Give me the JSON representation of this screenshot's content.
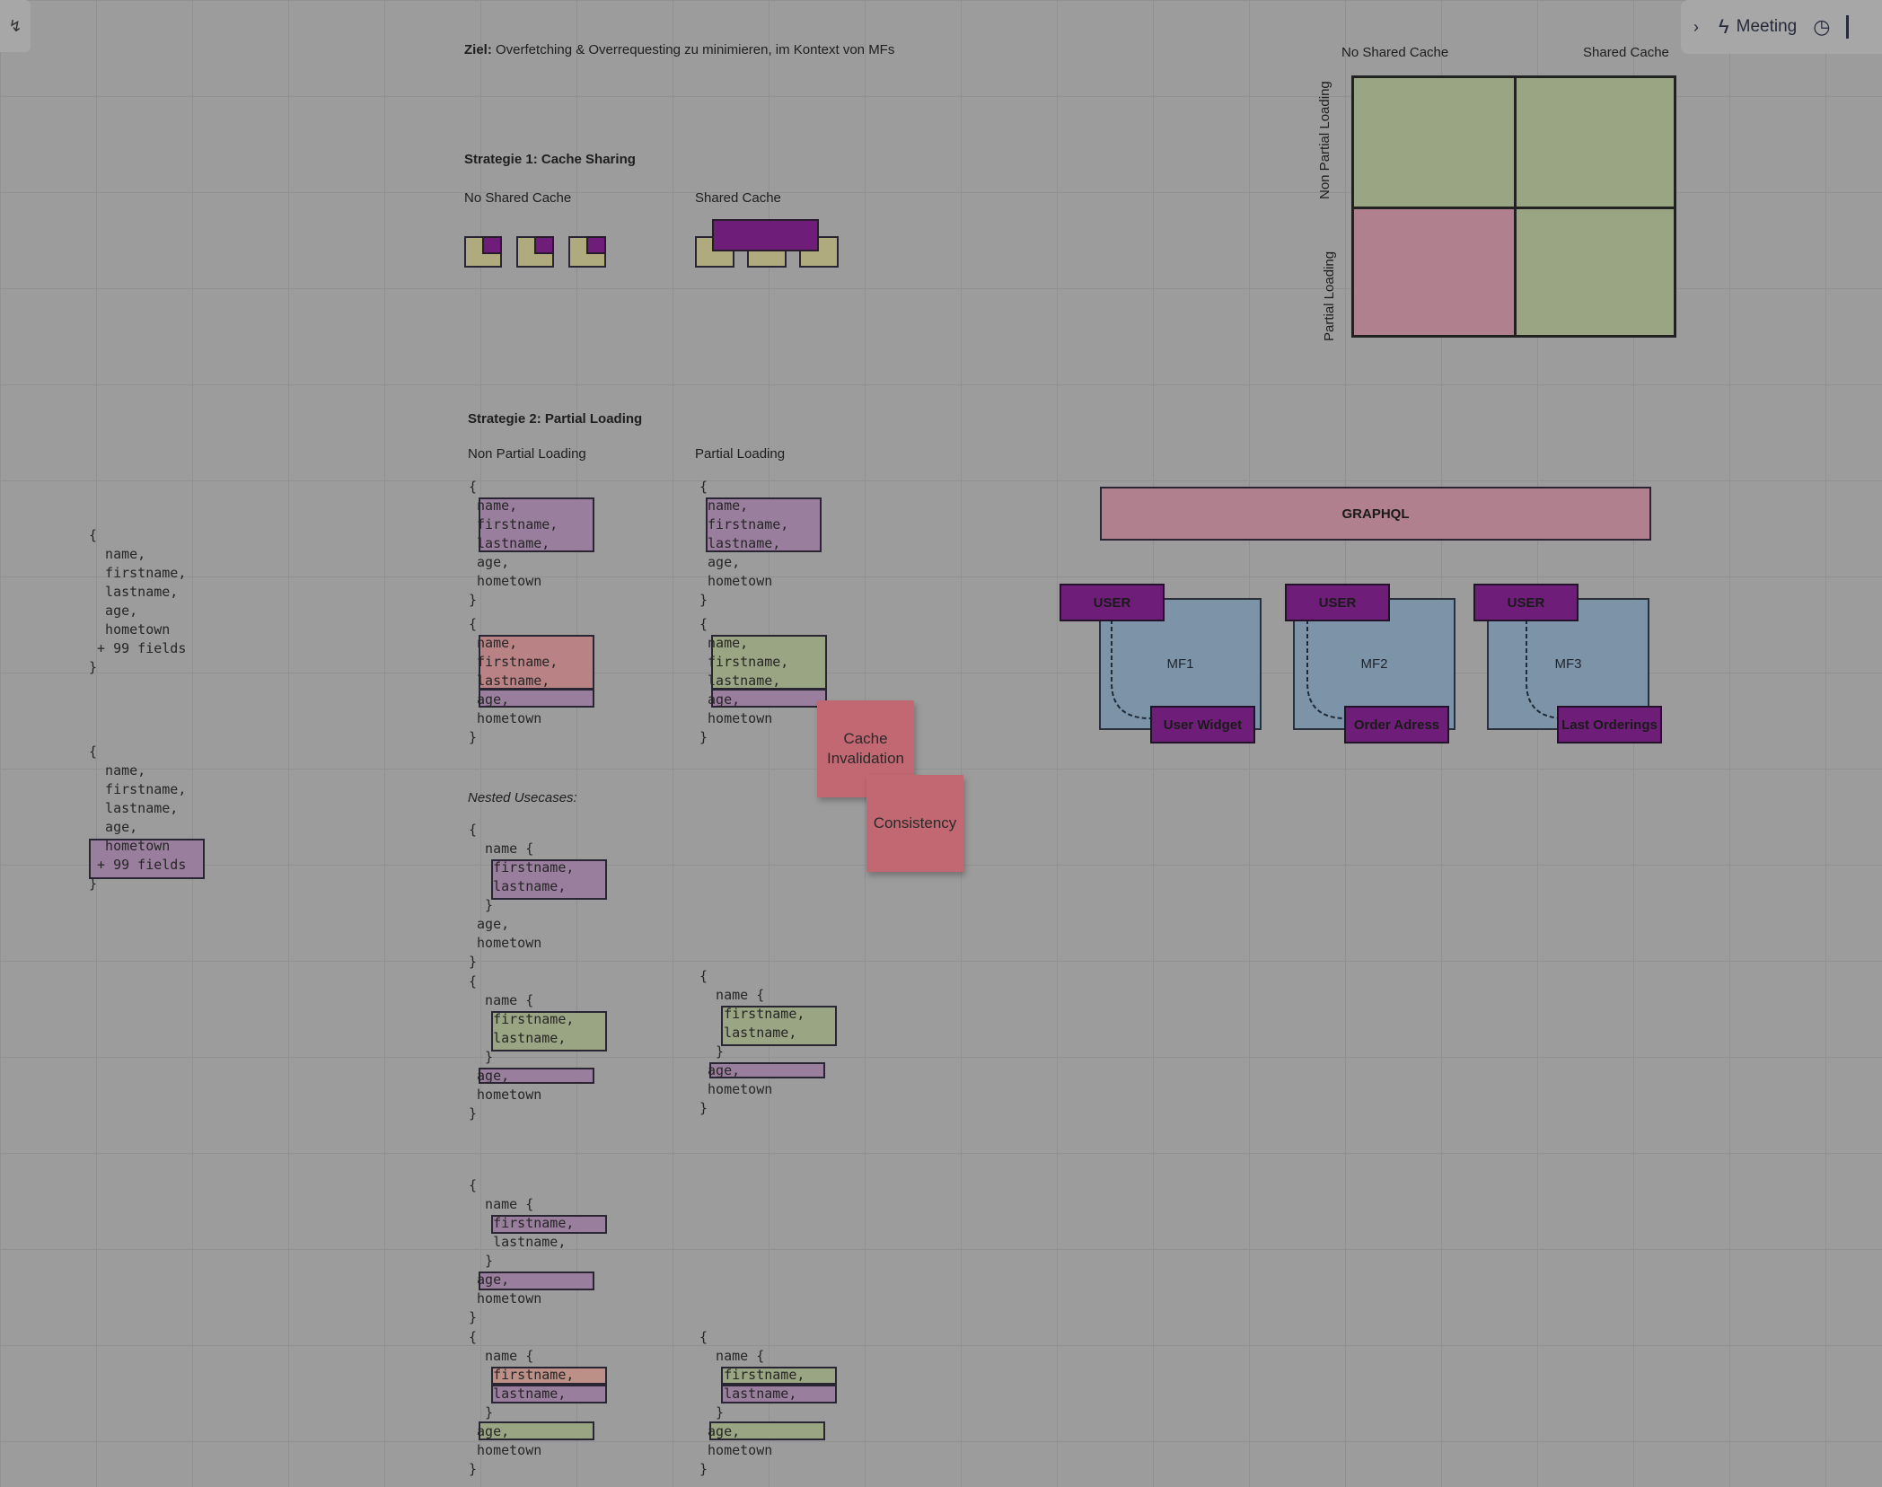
{
  "toolbar": {
    "meeting_label": "Meeting"
  },
  "goal": {
    "label": "Ziel:",
    "text": " Overfetching & Overrequesting zu minimieren, im Kontext von MFs"
  },
  "strategy1": {
    "title": "Strategie 1: Cache Sharing",
    "no_shared": "No Shared Cache",
    "shared": "Shared Cache"
  },
  "matrix": {
    "col1": "No Shared Cache",
    "col2": "Shared Cache",
    "row1": "Non Partial Loading",
    "row2": "Partial Loading"
  },
  "strategy2": {
    "title": "Strategie 2: Partial Loading",
    "non_partial": "Non Partial Loading",
    "partial": "Partial Loading",
    "nested": "Nested Usecases:"
  },
  "stickies": {
    "cache_invalidation": "Cache\nInvalidation",
    "consistency": "Consistency"
  },
  "graphql": {
    "label": "GRAPHQL"
  },
  "mfs": [
    {
      "tag": "USER",
      "name": "MF1",
      "widget": "User Widget"
    },
    {
      "tag": "USER",
      "name": "MF2",
      "widget": "Order Adress"
    },
    {
      "tag": "USER",
      "name": "MF3",
      "widget": "Last Orderings"
    }
  ],
  "code": {
    "left1": "{\n  name,\n  firstname,\n  lastname,\n  age,\n  hometown\n + 99 fields\n}",
    "left2": "{\n  name,\n  firstname,\n  lastname,\n  age,\n  hometown\n + 99 fields\n}",
    "b1": "{\n name,\n firstname,\n lastname,\n age,\n hometown\n}",
    "b2": "{\n name,\n firstname,\n lastname,\n age,\n hometown\n}",
    "b3": "{\n name,\n firstname,\n lastname,\n age,\n hometown\n}",
    "b4": "{\n name,\n firstname,\n lastname,\n age,\n hometown\n}",
    "n1": "{\n  name {\n   firstname,\n   lastname,\n  }\n age,\n hometown\n}",
    "n2": "{\n  name {\n   firstname,\n   lastname,\n  }\n age,\n hometown\n}",
    "n3": "{\n  name {\n   firstname,\n   lastname,\n  }\n age,\n hometown\n}",
    "n4": "{\n  name {\n   firstname,\n   lastname,\n  }\n age,\n hometown\n}",
    "n5": "{\n  name {\n   firstname,\n   lastname,\n  }\n age,\n hometown\n}",
    "n6": "{\n  name {\n   firstname,\n   lastname,\n  }\n age,\n hometown\n}"
  },
  "colors": {
    "olive": "#9aa583",
    "rose": "#b98285",
    "purple": "#6e1e78",
    "blue": "#7c93a8",
    "sticky": "#c26872"
  }
}
